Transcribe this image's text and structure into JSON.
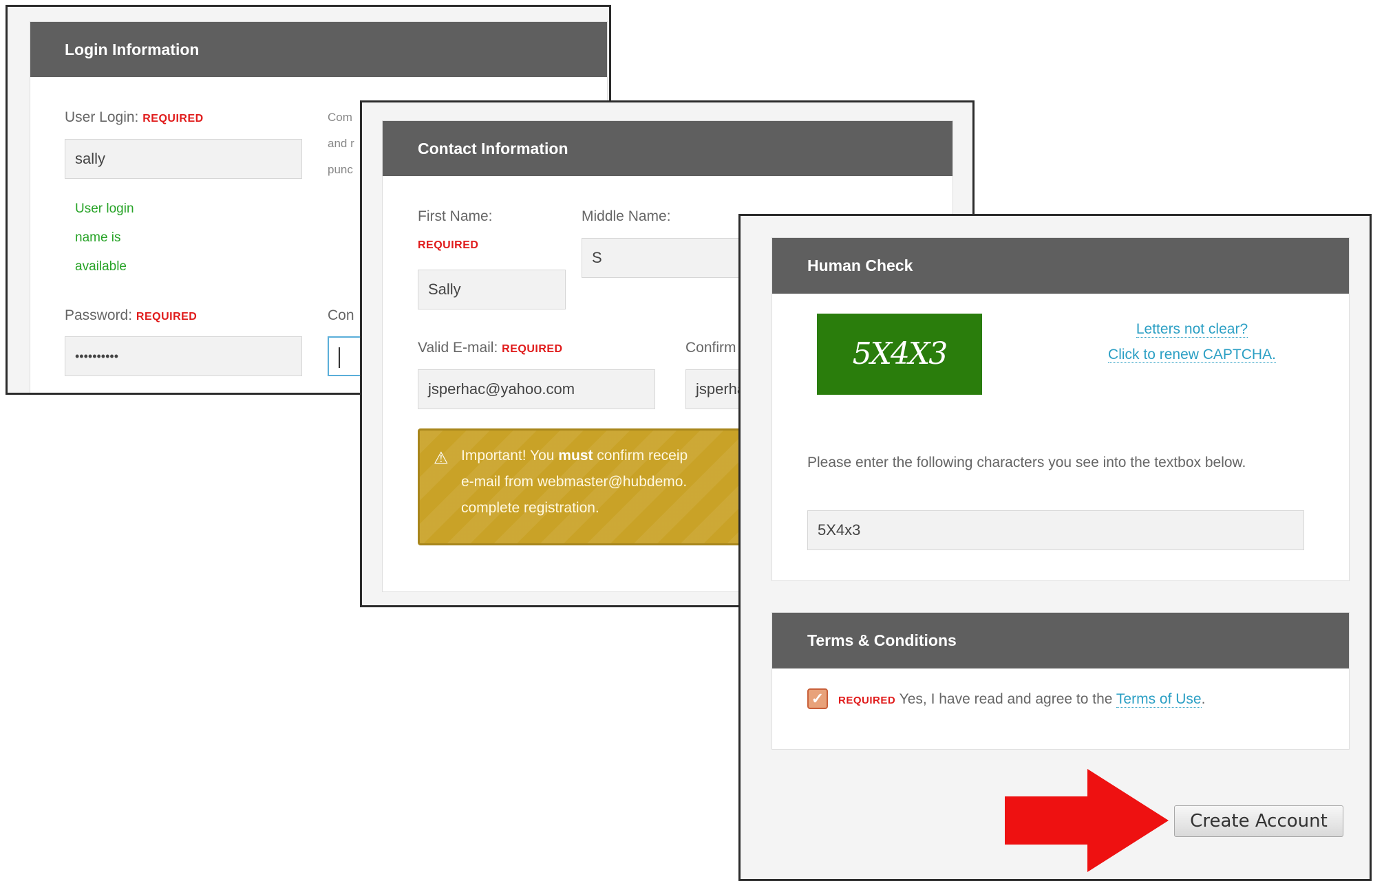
{
  "login": {
    "header": "Login Information",
    "user_login_label": "User Login:",
    "required": "REQUIRED",
    "user_login_value": "sally",
    "availability": [
      "User login",
      "name is",
      "available"
    ],
    "hint_lines": [
      "Com",
      "and r",
      "punc"
    ],
    "password_label": "Password:",
    "password_value": "••••••••••",
    "confirm_label": "Con"
  },
  "contact": {
    "header": "Contact Information",
    "first_name_label": "First Name:",
    "required": "REQUIRED",
    "first_name_value": "Sally",
    "middle_name_label": "Middle Name:",
    "middle_name_value": "S",
    "email_label": "Valid E-mail:",
    "email_value": "jsperhac@yahoo.com",
    "confirm_email_label": "Confirm",
    "confirm_email_value": "jsperha",
    "warning_prefix": "Important! You ",
    "warning_strong": "must",
    "warning_line1_rest": " confirm receip",
    "warning_line2": "e-mail from webmaster@hubdemo.",
    "warning_line3": "complete registration."
  },
  "human": {
    "header": "Human Check",
    "captcha_text": "5X4X3",
    "renew_line1": "Letters not clear?",
    "renew_line2": "Click to renew CAPTCHA.",
    "instructions": "Please enter the following characters you see into the textbox below.",
    "captcha_input": "5X4x3"
  },
  "terms": {
    "header": "Terms & Conditions",
    "required": "REQUIRED",
    "agree_text": "Yes, I have read and agree to the ",
    "terms_link": "Terms of Use",
    "period": "."
  },
  "actions": {
    "create_account": "Create Account"
  },
  "colors": {
    "header_bg": "#5f5f5f",
    "required": "#e01b1b",
    "link": "#2b9fc4",
    "available": "#27a327",
    "arrow": "#ee1111"
  }
}
